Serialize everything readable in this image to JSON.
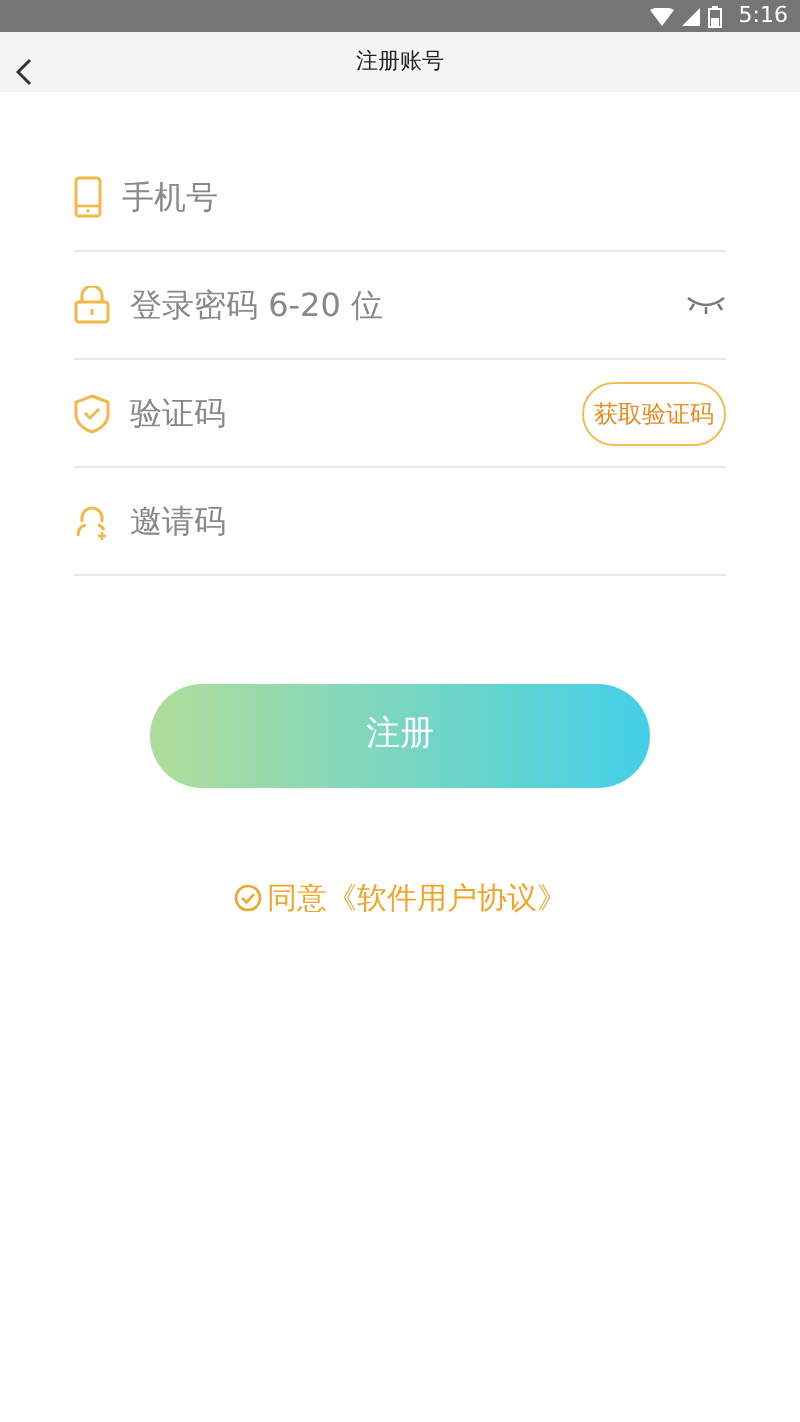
{
  "status_bar": {
    "time": "5:16"
  },
  "app_bar": {
    "title": "注册账号"
  },
  "fields": [
    {
      "kind": "phone",
      "placeholder": "手机号"
    },
    {
      "kind": "password",
      "placeholder": "登录密码 6-20 位",
      "password_visible": false
    },
    {
      "kind": "code",
      "placeholder": "验证码",
      "action": "获取验证码"
    },
    {
      "kind": "invite",
      "placeholder": "邀请码"
    }
  ],
  "submit": {
    "label": "注册"
  },
  "agreement": {
    "checked": true,
    "text": "同意《软件用户协议》"
  }
}
